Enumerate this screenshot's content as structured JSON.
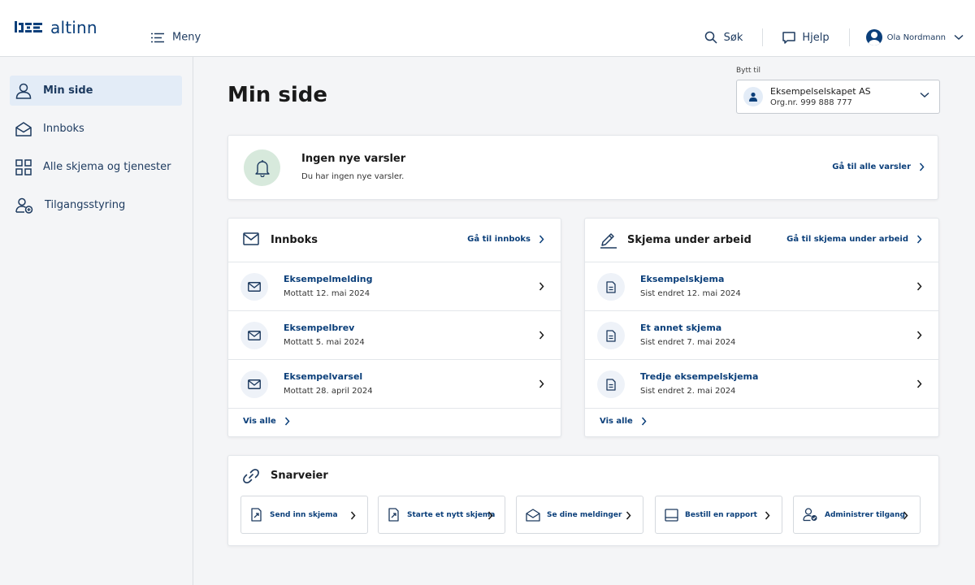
{
  "header": {
    "logo_text": "altinn",
    "menu_label": "Meny",
    "search_label": "Søk",
    "help_label": "Hjelp",
    "user_name": "Ola Nordmann"
  },
  "sidebar": {
    "items": [
      {
        "label": "Min side",
        "icon": "user-icon",
        "active": true
      },
      {
        "label": "Innboks",
        "icon": "inbox-icon"
      },
      {
        "label": "Alle skjema og tjenester",
        "icon": "grid-icon"
      },
      {
        "label": "Tilgangsstyring",
        "icon": "access-icon"
      }
    ]
  },
  "main": {
    "title": "Min side",
    "switcher": {
      "label": "Bytt til",
      "name": "Eksempelselskapet AS",
      "org": "Org.nr. 999 888 777"
    },
    "alerts": {
      "title": "Ingen nye varsler",
      "subtitle": "Du har ingen nye varsler.",
      "link": "Gå til alle varsler"
    },
    "inbox": {
      "title": "Innboks",
      "link": "Gå til innboks",
      "items": [
        {
          "title": "Eksempelmelding",
          "sub": "Mottatt 12. mai 2024"
        },
        {
          "title": "Eksempelbrev",
          "sub": "Mottatt 5. mai 2024"
        },
        {
          "title": "Eksempelvarsel",
          "sub": "Mottatt 28. april 2024"
        }
      ],
      "view_all": "Vis alle"
    },
    "forms": {
      "title": "Skjema under arbeid",
      "link": "Gå til skjema under arbeid",
      "items": [
        {
          "title": "Eksempelskjema",
          "sub": "Sist endret 12. mai 2024"
        },
        {
          "title": "Et annet skjema",
          "sub": "Sist endret 7. mai 2024"
        },
        {
          "title": "Tredje eksempelskjema",
          "sub": "Sist endret 2. mai 2024"
        }
      ],
      "view_all": "Vis alle"
    },
    "shortcuts": {
      "title": "Snarveier",
      "items": [
        {
          "label": "Send inn skjema",
          "icon": "send-form-icon"
        },
        {
          "label": "Starte et nytt skjema",
          "icon": "new-form-icon"
        },
        {
          "label": "Se dine meldinger",
          "icon": "open-mail-icon"
        },
        {
          "label": "Bestill en rapport",
          "icon": "report-icon"
        },
        {
          "label": "Administrer tilgang",
          "icon": "admin-access-icon"
        }
      ]
    }
  },
  "colors": {
    "brand": "#0b3f7a",
    "sidebar_bg": "#f4f5f7",
    "active_bg": "#e3ecf7",
    "bell_bg": "#d7e9dc"
  }
}
